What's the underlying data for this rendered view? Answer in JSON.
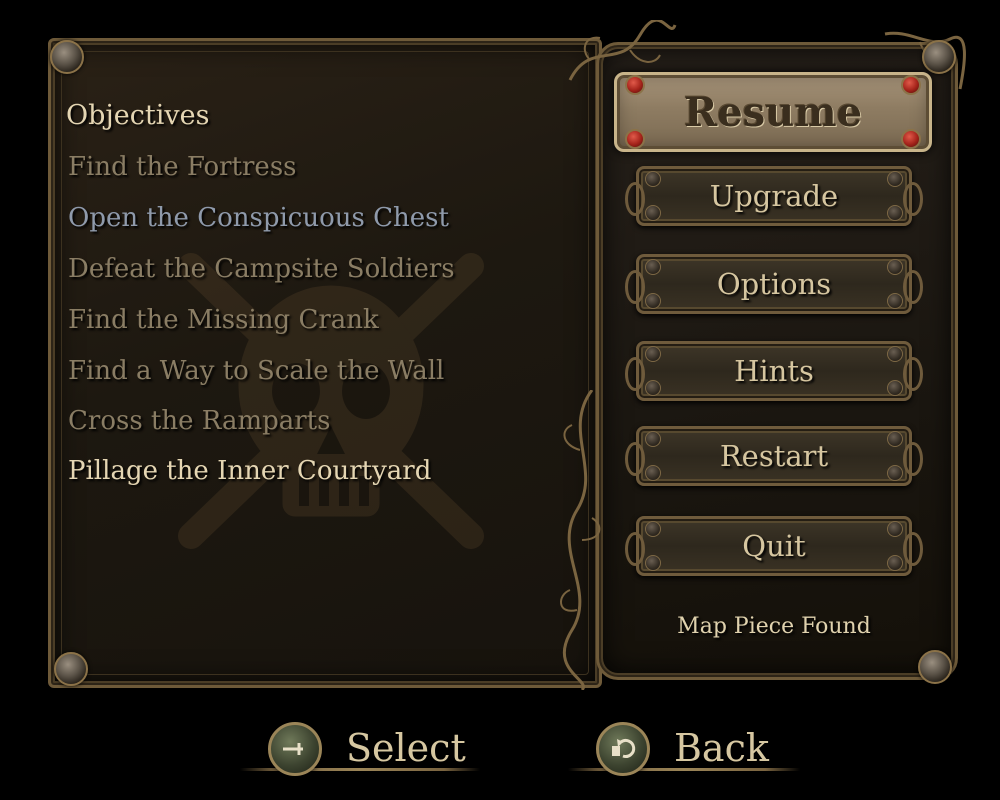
{
  "objectives": {
    "title": "Objectives",
    "items": [
      {
        "label": "Find the Fortress",
        "color": "#8a7d64"
      },
      {
        "label": "Open the Conspicuous Chest",
        "color": "#8f9aab"
      },
      {
        "label": "Defeat the Campsite Soldiers",
        "color": "#8a7d64"
      },
      {
        "label": "Find the Missing Crank",
        "color": "#8a7d64"
      },
      {
        "label": "Find a Way to Scale the Wall",
        "color": "#8a7d64"
      },
      {
        "label": "Cross the Ramparts",
        "color": "#8a7d64"
      },
      {
        "label": "Pillage the Inner Courtyard",
        "color": "#e5d6b3"
      }
    ]
  },
  "menu": {
    "resume": "Resume",
    "upgrade": "Upgrade",
    "options": "Options",
    "hints": "Hints",
    "restart": "Restart",
    "quit": "Quit",
    "status": "Map Piece Found"
  },
  "prompts": {
    "select_label": "Select",
    "back_label": "Back"
  },
  "colors": {
    "frame": "#6e5a39",
    "text_normal": "#d6c6a0",
    "text_highlight": "#e5d6b3",
    "text_completed": "#8a7d64",
    "text_selected_objective": "#8f9aab",
    "accent_red": "#a4231a"
  },
  "icons": {
    "select_button": "sword-icon",
    "back_button": "return-arrow-icon"
  }
}
